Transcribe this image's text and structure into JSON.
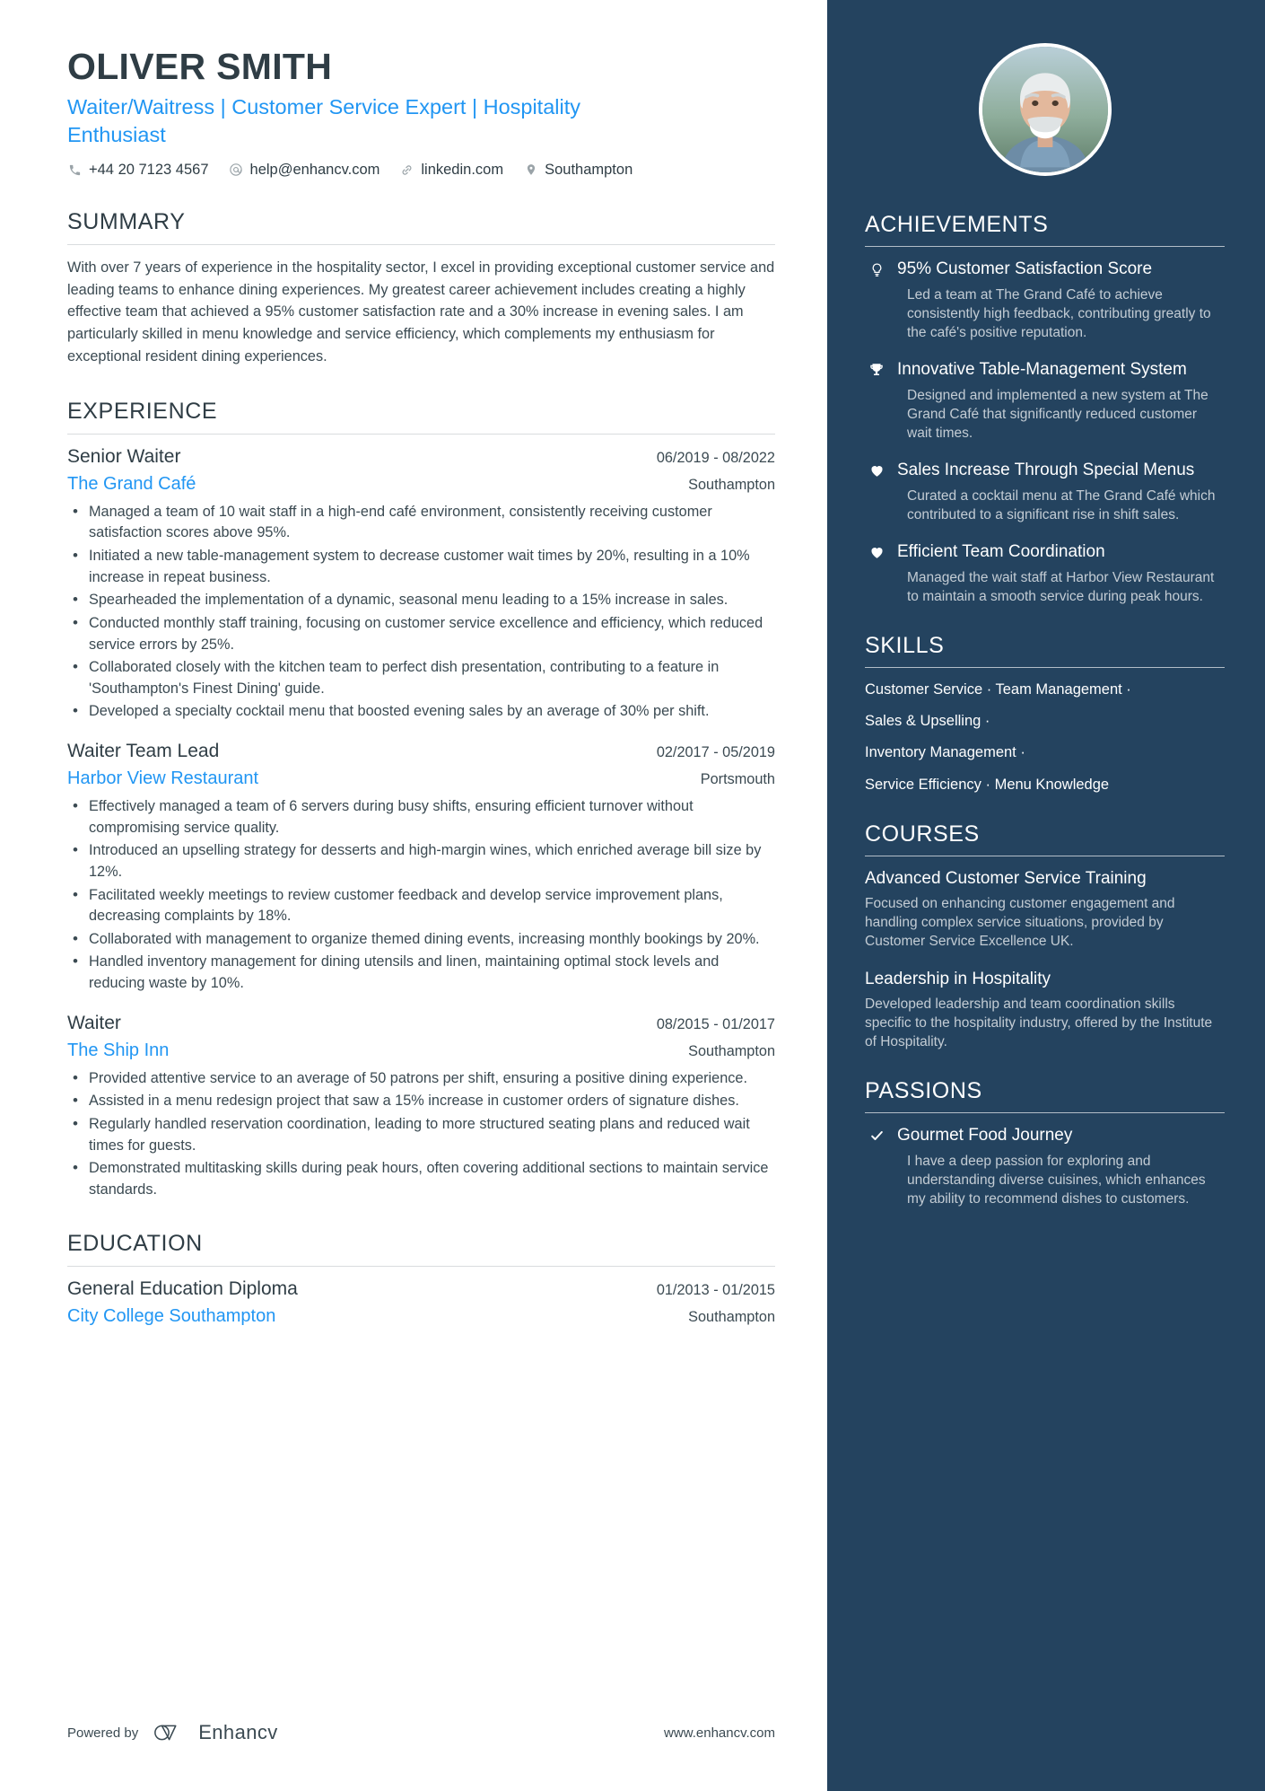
{
  "colors": {
    "accent_blue": "#2196f3",
    "sidebar_bg": "#24435f",
    "text_dark": "#2f3d45",
    "text_body": "#3b4a52",
    "sidebar_muted": "#c3ccd4"
  },
  "header": {
    "name": "OLIVER SMITH",
    "headline": "Waiter/Waitress | Customer Service Expert | Hospitality Enthusiast",
    "contacts": [
      {
        "icon": "phone-icon",
        "value": "+44 20 7123 4567"
      },
      {
        "icon": "email-icon",
        "value": "help@enhancv.com"
      },
      {
        "icon": "link-icon",
        "value": "linkedin.com"
      },
      {
        "icon": "location-pin-icon",
        "value": "Southampton"
      }
    ]
  },
  "summary": {
    "title": "SUMMARY",
    "text": "With over 7 years of experience in the hospitality sector, I excel in providing exceptional customer service and leading teams to enhance dining experiences. My greatest career achievement includes creating a highly effective team that achieved a 95% customer satisfaction rate and a 30% increase in evening sales. I am particularly skilled in menu knowledge and service efficiency, which complements my enthusiasm for exceptional resident dining experiences."
  },
  "experience": {
    "title": "EXPERIENCE",
    "jobs": [
      {
        "role": "Senior Waiter",
        "dates": "06/2019 - 08/2022",
        "company": "The Grand Café",
        "location": "Southampton",
        "bullets": [
          "Managed a team of 10 wait staff in a high-end café environment, consistently receiving customer satisfaction scores above 95%.",
          "Initiated a new table-management system to decrease customer wait times by 20%, resulting in a 10% increase in repeat business.",
          "Spearheaded the implementation of a dynamic, seasonal menu leading to a 15% increase in sales.",
          "Conducted monthly staff training, focusing on customer service excellence and efficiency, which reduced service errors by 25%.",
          "Collaborated closely with the kitchen team to perfect dish presentation, contributing to a feature in 'Southampton's Finest Dining' guide.",
          "Developed a specialty cocktail menu that boosted evening sales by an average of 30% per shift."
        ]
      },
      {
        "role": "Waiter Team Lead",
        "dates": "02/2017 - 05/2019",
        "company": "Harbor View Restaurant",
        "location": "Portsmouth",
        "bullets": [
          "Effectively managed a team of 6 servers during busy shifts, ensuring efficient turnover without compromising service quality.",
          "Introduced an upselling strategy for desserts and high-margin wines, which enriched average bill size by 12%.",
          "Facilitated weekly meetings to review customer feedback and develop service improvement plans, decreasing complaints by 18%.",
          "Collaborated with management to organize themed dining events, increasing monthly bookings by 20%.",
          "Handled inventory management for dining utensils and linen, maintaining optimal stock levels and reducing waste by 10%."
        ]
      },
      {
        "role": "Waiter",
        "dates": "08/2015 - 01/2017",
        "company": "The Ship Inn",
        "location": "Southampton",
        "bullets": [
          "Provided attentive service to an average of 50 patrons per shift, ensuring a positive dining experience.",
          "Assisted in a menu redesign project that saw a 15% increase in customer orders of signature dishes.",
          "Regularly handled reservation coordination, leading to more structured seating plans and reduced wait times for guests.",
          "Demonstrated multitasking skills during peak hours, often covering additional sections to maintain service standards."
        ]
      }
    ]
  },
  "education": {
    "title": "EDUCATION",
    "entries": [
      {
        "degree": "General Education Diploma",
        "dates": "01/2013 - 01/2015",
        "school": "City College Southampton",
        "location": "Southampton"
      }
    ]
  },
  "footer": {
    "powered_by": "Powered by",
    "brand": "Enhancv",
    "url": "www.enhancv.com"
  },
  "sidebar": {
    "achievements": {
      "title": "ACHIEVEMENTS",
      "items": [
        {
          "icon": "lightbulb-icon",
          "title": "95% Customer Satisfaction Score",
          "desc": "Led a team at The Grand Café to achieve consistently high feedback, contributing greatly to the café's positive reputation."
        },
        {
          "icon": "trophy-icon",
          "title": "Innovative Table-Management System",
          "desc": "Designed and implemented a new system at The Grand Café that significantly reduced customer wait times."
        },
        {
          "icon": "heart-icon",
          "title": "Sales Increase Through Special Menus",
          "desc": "Curated a cocktail menu at The Grand Café which contributed to a significant rise in shift sales."
        },
        {
          "icon": "heart-icon",
          "title": "Efficient Team Coordination",
          "desc": "Managed the wait staff at Harbor View Restaurant to maintain a smooth service during peak hours."
        }
      ]
    },
    "skills": {
      "title": "SKILLS",
      "lines": [
        "Customer Service · Team Management ·",
        "Sales & Upselling ·",
        "Inventory Management ·",
        "Service Efficiency · Menu Knowledge"
      ]
    },
    "courses": {
      "title": "COURSES",
      "items": [
        {
          "title": "Advanced Customer Service Training",
          "desc": "Focused on enhancing customer engagement and handling complex service situations, provided by Customer Service Excellence UK."
        },
        {
          "title": "Leadership in Hospitality",
          "desc": "Developed leadership and team coordination skills specific to the hospitality industry, offered by the Institute of Hospitality."
        }
      ]
    },
    "passions": {
      "title": "PASSIONS",
      "items": [
        {
          "icon": "check-icon",
          "title": "Gourmet Food Journey",
          "desc": "I have a deep passion for exploring and understanding diverse cuisines, which enhances my ability to recommend dishes to customers."
        }
      ]
    }
  }
}
